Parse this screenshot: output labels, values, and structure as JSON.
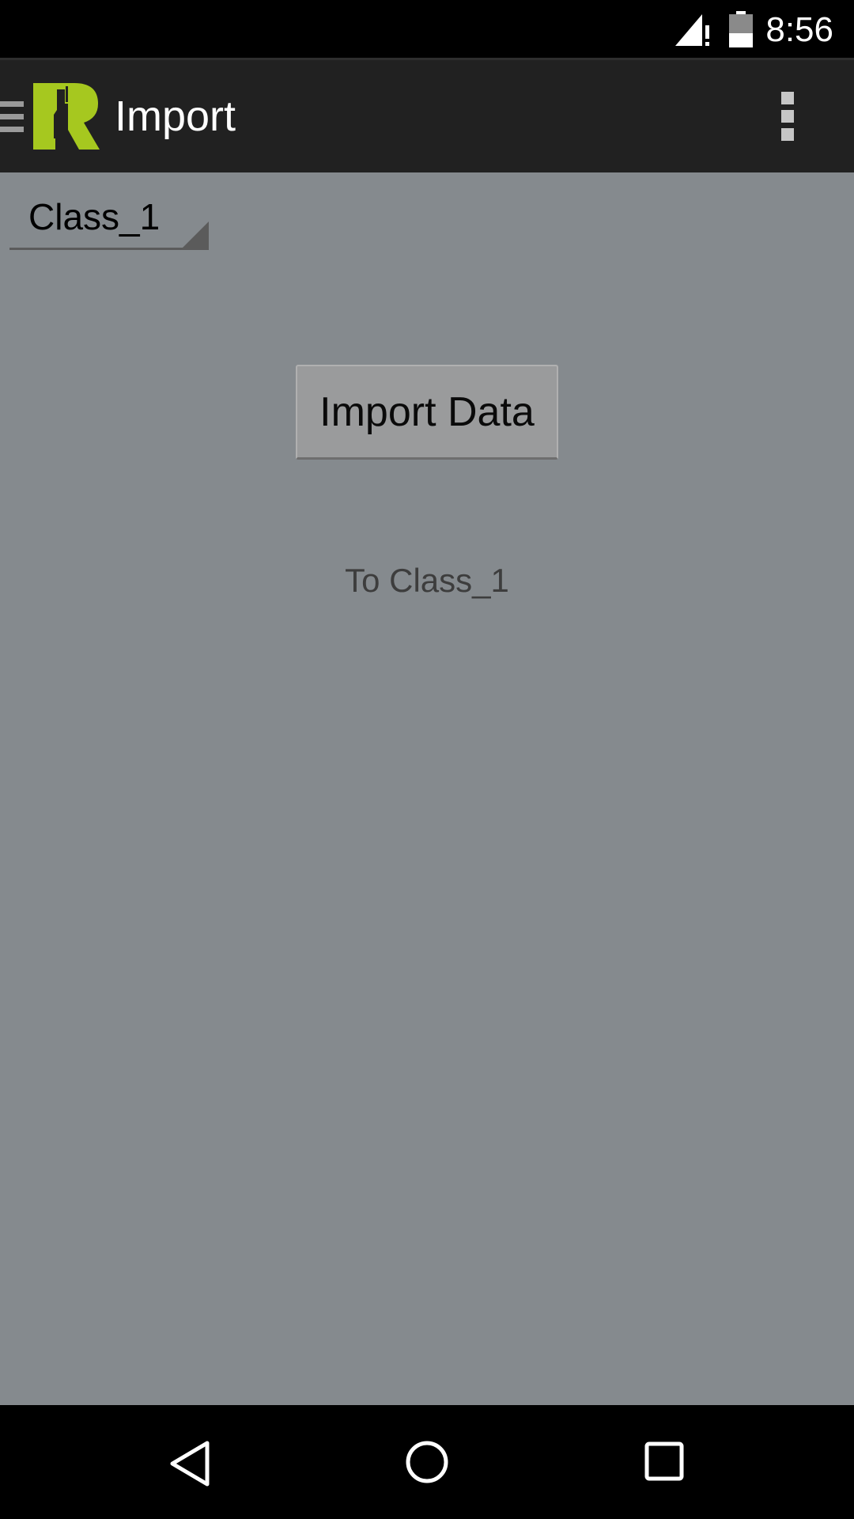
{
  "status_bar": {
    "time": "8:56",
    "signal_icon": "signal-no-data-icon",
    "battery_icon": "battery-icon"
  },
  "action_bar": {
    "title": "Import",
    "drawer_icon": "menu-icon",
    "logo": "app-logo",
    "overflow_icon": "more-vert-icon"
  },
  "spinner": {
    "selected": "Class_1"
  },
  "main": {
    "import_button_label": "Import Data",
    "target_label": "To Class_1"
  },
  "nav_bar": {
    "back_icon": "back-icon",
    "home_icon": "home-icon",
    "recents_icon": "recents-icon"
  },
  "colors": {
    "background": "#858a8e",
    "action_bar": "#212121",
    "logo_accent": "#a6c81f",
    "status_bar": "#000000"
  }
}
